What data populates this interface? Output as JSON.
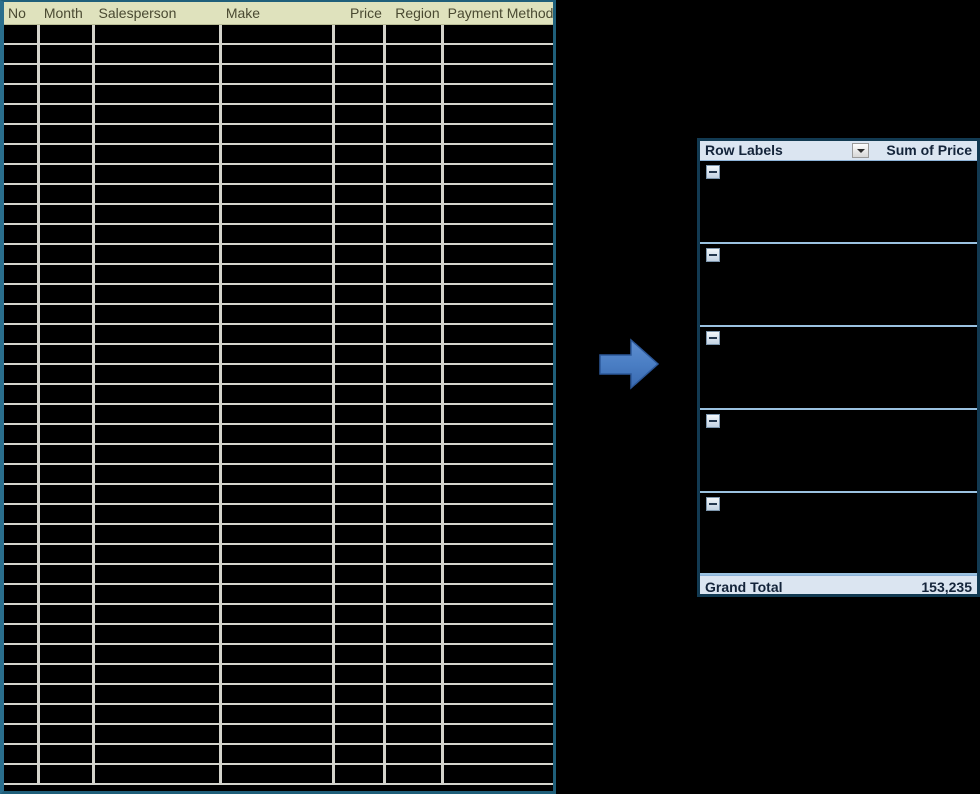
{
  "source_table": {
    "name": "sales-source-data",
    "columns": [
      {
        "label": "No",
        "align": "right"
      },
      {
        "label": "Month",
        "align": "left"
      },
      {
        "label": "Salesperson",
        "align": "left"
      },
      {
        "label": "Make",
        "align": "left"
      },
      {
        "label": "Price",
        "align": "right"
      },
      {
        "label": "Region",
        "align": "right"
      },
      {
        "label": "Payment Method",
        "align": "left"
      }
    ],
    "row_count": 38,
    "cells_redacted": true,
    "header_bg": "#dfe2bd",
    "header_text_color": "#4a4a32",
    "border_color": "#1f5f7a",
    "gridline_color": "#d4d4cc",
    "body_bg": "#000000"
  },
  "arrow": {
    "name": "flow-arrow",
    "direction": "right",
    "fill": "#4a7ec4",
    "stroke": "#2c5899"
  },
  "pivot_table": {
    "name": "pivot-table",
    "header": {
      "row_labels": "Row Labels",
      "sum_of_price": "Sum of Price",
      "filter_icon": "chevron-down-icon"
    },
    "groups": [
      {
        "collapse_icon": "collapse-minus-icon",
        "label": "",
        "value": ""
      },
      {
        "collapse_icon": "collapse-minus-icon",
        "label": "",
        "value": ""
      },
      {
        "collapse_icon": "collapse-minus-icon",
        "label": "",
        "value": ""
      },
      {
        "collapse_icon": "collapse-minus-icon",
        "label": "",
        "value": ""
      },
      {
        "collapse_icon": "collapse-minus-icon",
        "label": "",
        "value": ""
      }
    ],
    "grand_total": {
      "label": "Grand Total",
      "value": "153,235"
    },
    "header_bg": "#dbe5f1",
    "header_text_color": "#14243a",
    "border_color": "#123a52",
    "separator_color": "#9bc2e0",
    "body_bg": "#000000"
  }
}
